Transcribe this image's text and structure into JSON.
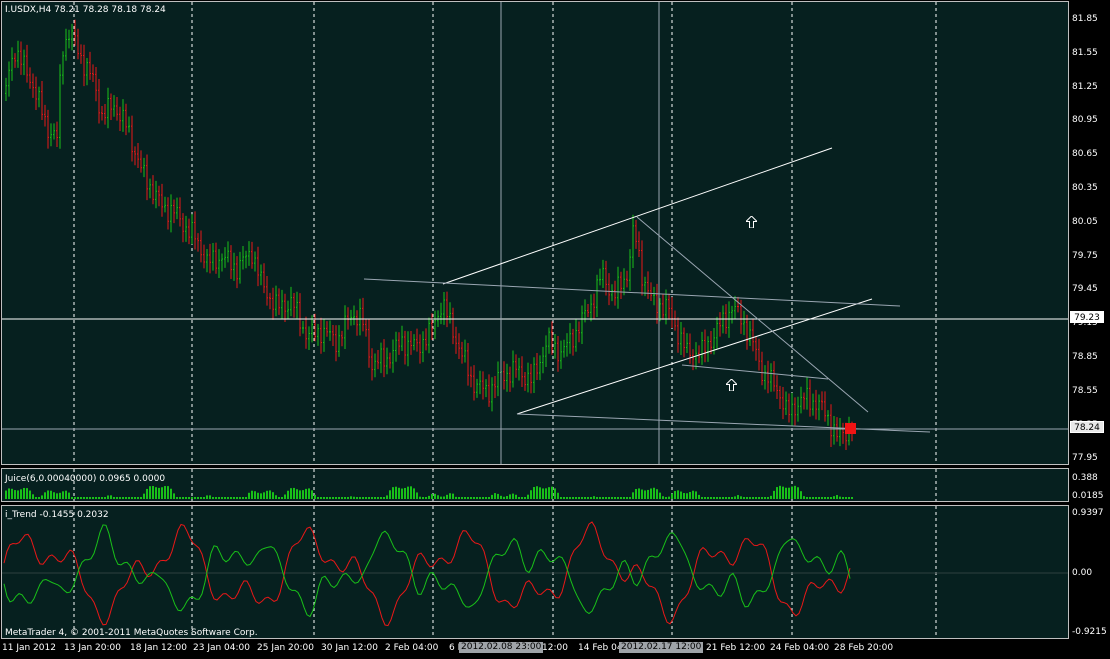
{
  "main": {
    "header": "I.USDX,H4  78.21 78.28 78.18 78.24",
    "y_ticks": [
      "81.85",
      "81.55",
      "81.25",
      "80.95",
      "80.65",
      "80.35",
      "80.05",
      "79.75",
      "79.45",
      "79.15",
      "78.85",
      "78.55",
      "78.25",
      "77.95"
    ],
    "hline_label": "79.23",
    "current_price": "78.24"
  },
  "juice": {
    "header": "Juice(6,0.00040000) 0.0965 0.0000",
    "y_ticks": [
      "0.388",
      "0.0185"
    ]
  },
  "trend": {
    "header": "i_Trend -0.1455 0.2032",
    "y_ticks": [
      "0.9397",
      "0.00",
      "-0.9215"
    ],
    "copyright": "MetaTrader 4, © 2001-2011 MetaQuotes Software Corp."
  },
  "xaxis": {
    "labels": [
      "11 Jan 2012",
      "13 Jan 20:00",
      "18 Jan 12:00",
      "23 Jan 04:00",
      "25 Jan 20:00",
      "30 Jan 12:00",
      "2 Feb 04:00",
      "6 F",
      "12:00",
      "14 Feb 04:00",
      "21 Feb 12:00",
      "24 Feb 04:00",
      "28 Feb 20:00"
    ],
    "highlight_1": "2012.02.08 23:00",
    "highlight_2": "2012.02.17 12:00"
  },
  "colors": {
    "bull": "#19c019",
    "bear": "#e81818",
    "panel_bg": "#06201f",
    "grid": "#ffffff"
  }
}
